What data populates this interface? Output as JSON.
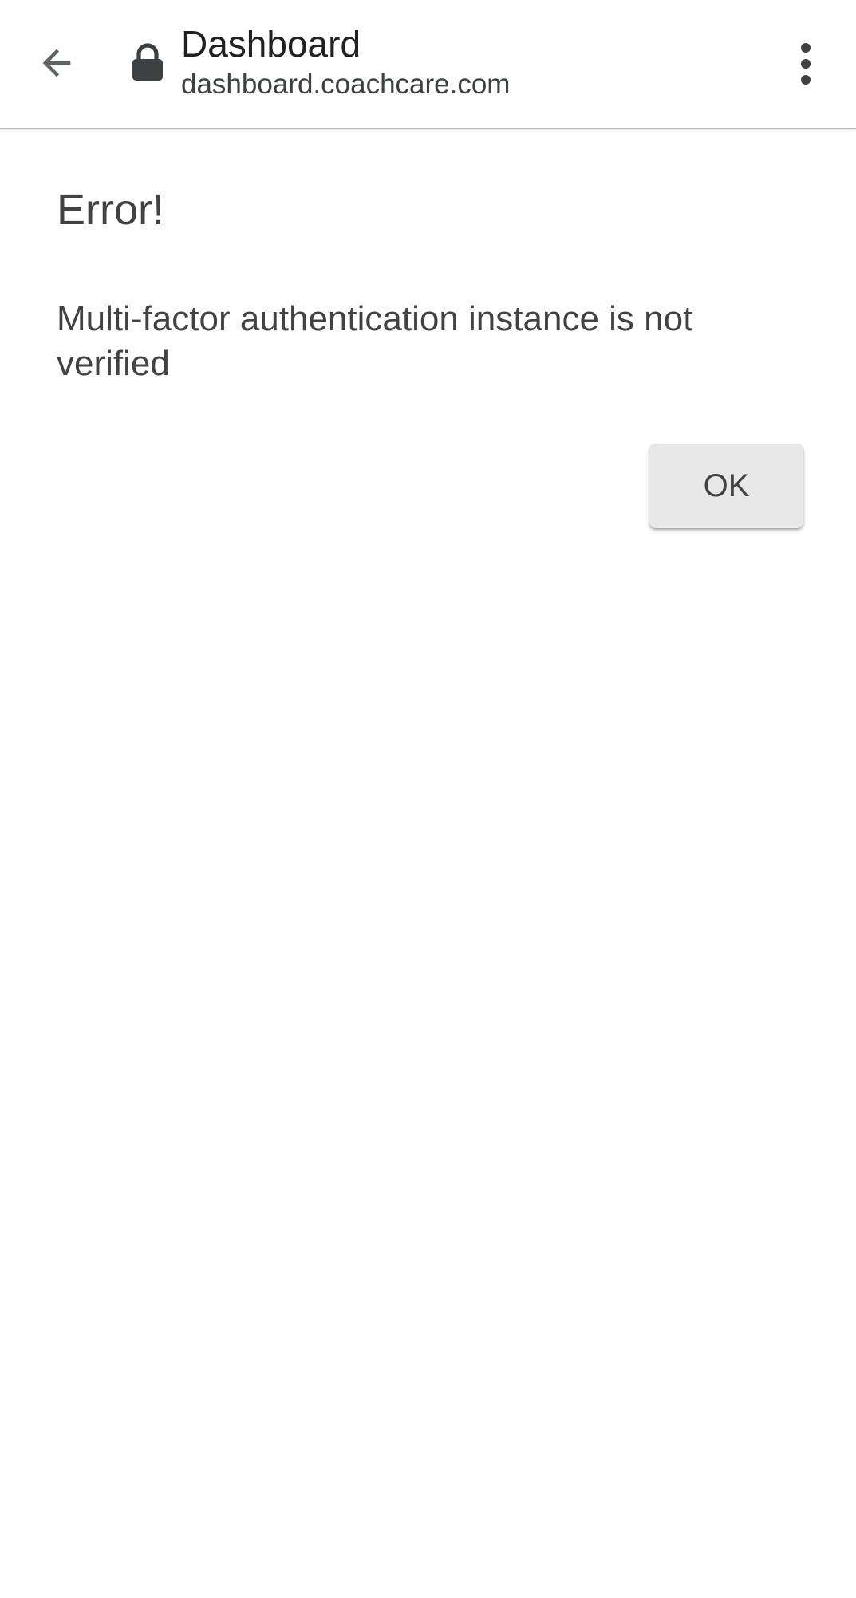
{
  "browser": {
    "page_title": "Dashboard",
    "url": "dashboard.coachcare.com",
    "icons": {
      "back": "arrow-back-icon",
      "secure": "lock-icon",
      "menu": "more-vertical-icon"
    }
  },
  "dialog": {
    "title": "Error!",
    "message": "Multi-factor authentication instance is not verified",
    "ok_label": "OK"
  },
  "colors": {
    "text_primary": "#424242",
    "button_bg": "#e8e8e8",
    "toolbar_icon": "#5f6368"
  }
}
